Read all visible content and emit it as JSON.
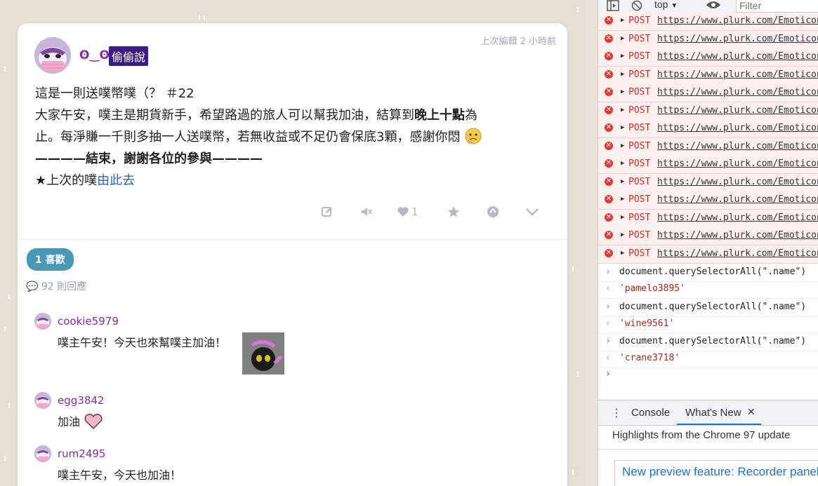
{
  "post": {
    "nickname": "ʘ‿ʘ",
    "badge": "偷偷說",
    "timestamp": "上次編輯 2 小時前",
    "line1": "這是一則送噗幣噗（？ ＃22",
    "line2_a": "大家午安，噗主是期貨新手，希望路過的旅人可以幫我加油，結算到",
    "line2_bold": "晚上十點",
    "line2_b": "為",
    "line3": "止。每淨賺一千則多抽一人送噗幣，若無收益或不足仍會保底3顆，感謝你悶",
    "line4": "————結束，謝謝各位的參與————",
    "line5_prefix": "★上次的噗",
    "line5_link": "由此去",
    "like_count": "1"
  },
  "likes_pill": "1 喜歡",
  "reply_count": "92 則回應",
  "replies": [
    {
      "name": "cookie5979",
      "text": "噗主午安！今天也來幫噗主加油！"
    },
    {
      "name": "egg3842",
      "text": "加油"
    },
    {
      "name": "rum2495",
      "text": "噗主午安，今天也加油！"
    }
  ],
  "devtools": {
    "context": "top",
    "filter_placeholder": "Filter",
    "error_method": "POST",
    "error_url": "https://www.plurk.com/Emoticons",
    "console": [
      {
        "cmd": "document.querySelectorAll(\".name\")",
        "result": "'pamelo3895'"
      },
      {
        "cmd": "document.querySelectorAll(\".name\")",
        "result": "'wine9561'"
      },
      {
        "cmd": "document.querySelectorAll(\".name\")",
        "result": "'crane3718'"
      }
    ],
    "tab_console": "Console",
    "tab_whatsnew": "What's New",
    "highlights": "Highlights from the Chrome 97 update",
    "preview_link": "New preview feature: Recorder panel"
  },
  "colors": {
    "nick": "#8a2aa8",
    "badge": "#3d1b86",
    "link": "#2a6ac0",
    "pill": "#4a98b7",
    "error": "#d32f2f"
  }
}
